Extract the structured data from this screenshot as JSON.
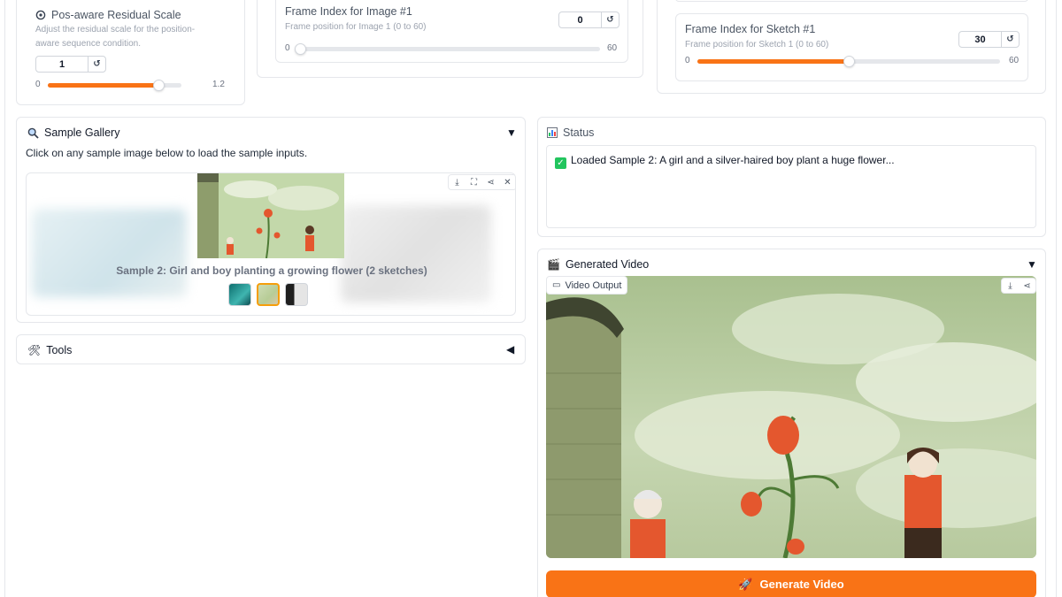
{
  "residual_scale": {
    "title": "Pos-aware Residual Scale",
    "description": "Adjust the residual scale for the position-aware sequence condition.",
    "value": "1",
    "min": "0",
    "max": "1.2",
    "level_fraction": 0.83,
    "icon": "gear-icon"
  },
  "frame_image": {
    "title": "Frame Index for Image #1",
    "description": "Frame position for Image 1 (0 to 60)",
    "value": "0",
    "min": "0",
    "max": "60",
    "level_fraction": 0.0
  },
  "frame_sketch": {
    "title": "Frame Index for Sketch #1",
    "description": "Frame position for Sketch 1 (0 to 60)",
    "value": "30",
    "min": "0",
    "max": "60",
    "level_fraction": 0.5
  },
  "sample_gallery": {
    "title": "Sample Gallery",
    "icon": "magnifier-icon",
    "instruction": "Click on any sample image below to load the sample inputs.",
    "caption": "Sample 2: Girl and boy planting a growing flower (2 sketches)",
    "selected_index": 1
  },
  "tools": {
    "title": "Tools",
    "icon": "hammer-wrench-icon"
  },
  "status": {
    "title": "Status",
    "icon": "bar-chart-icon",
    "message": "Loaded Sample 2: A girl and a silver-haired boy plant a huge flower..."
  },
  "generated_video": {
    "title": "Generated Video",
    "icon": "clapper-board-icon",
    "output_label": "Video Output"
  },
  "generate_button": {
    "label": "Generate Video",
    "icon": "rocket-icon"
  },
  "colors": {
    "accent": "#f97316",
    "border": "#e5e7eb",
    "success": "#22c55e"
  }
}
